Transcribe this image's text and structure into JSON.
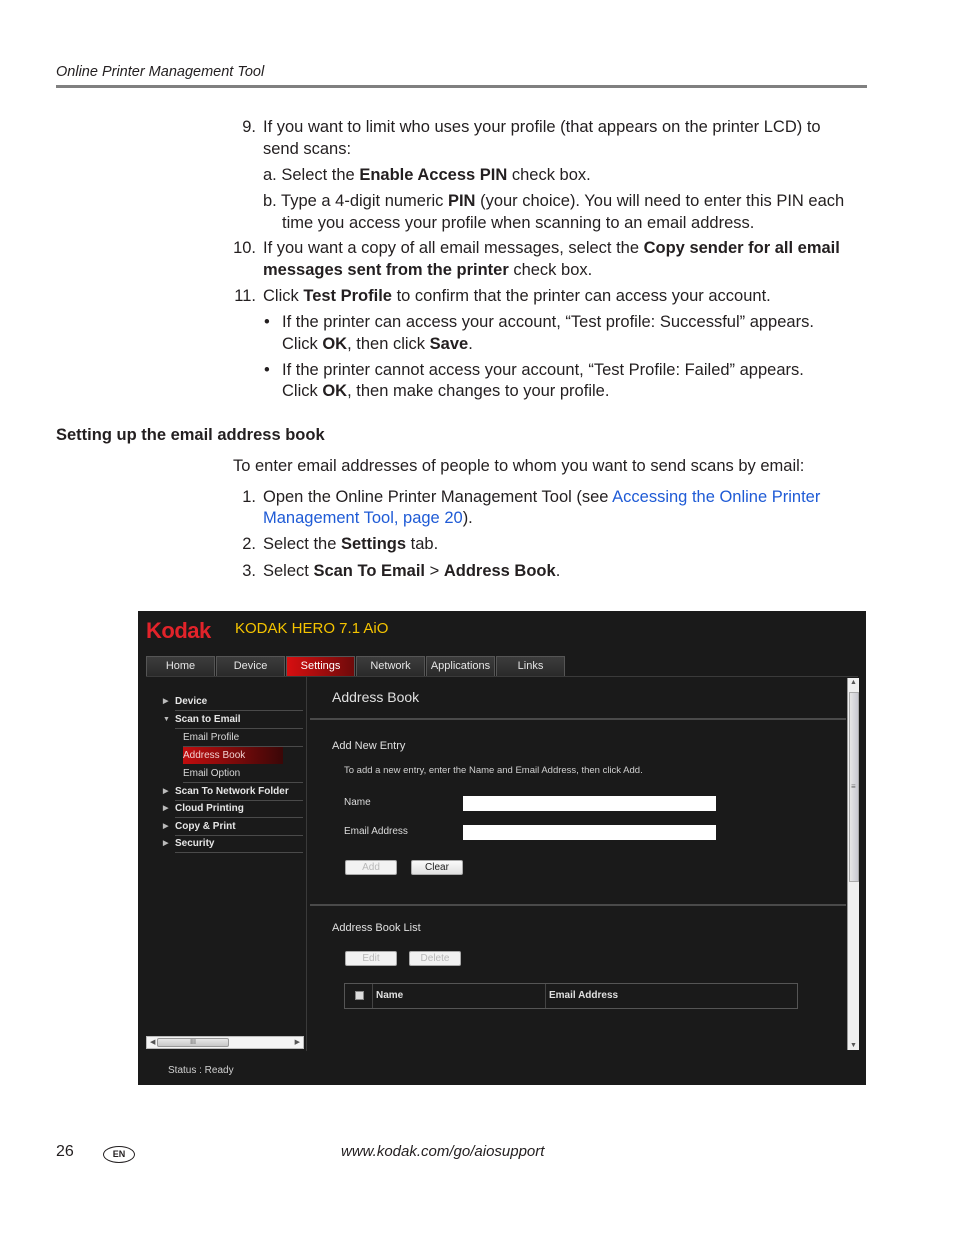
{
  "header": {
    "running_title": "Online Printer Management Tool"
  },
  "steps_top": [
    {
      "num": "9.",
      "text_html": "If you want to limit who uses your profile (that appears on the printer LCD) to"
    },
    {
      "num": "",
      "text_html": "send scans:"
    }
  ],
  "step9": {
    "num": "9.",
    "line1": "If you want to limit who uses your profile (that appears on the printer LCD) to",
    "line2": "send scans:",
    "a": {
      "pre": "a. Select the ",
      "bold": "Enable Access PIN",
      "post": " check box."
    },
    "b": {
      "pre": "b. Type a 4-digit numeric ",
      "bold": "PIN",
      "post": " (your choice). You will need to enter this PIN each",
      "line2": "time you access your profile when scanning to an email address."
    }
  },
  "step10": {
    "num": "10.",
    "pre": "If you want a copy of all email messages, select the ",
    "bold1": "Copy sender for all email",
    "bold2": "messages sent from the printer",
    "post": " check box."
  },
  "step11": {
    "num": "11.",
    "pre": "Click ",
    "bold": "Test Profile",
    "post": " to confirm that the printer can access your account.",
    "bullets": [
      {
        "line1": "If the printer can access your account, “Test profile: Successful” appears.",
        "pre": "Click ",
        "b1": "OK",
        "mid": ", then click ",
        "b2": "Save",
        "post": "."
      },
      {
        "line1": "If the printer cannot access your account, “Test Profile: Failed” appears.",
        "pre": "Click ",
        "b1": "OK",
        "mid": ", then make changes to your profile.",
        "b2": "",
        "post": ""
      }
    ]
  },
  "section": {
    "title": "Setting up the email address book",
    "intro": "To enter email addresses of people to whom you want to send scans by email:",
    "steps": [
      {
        "num": "1.",
        "pre": "Open the Online Printer Management Tool (see ",
        "link1": "Accessing the Online Printer",
        "link2": "Management Tool, page 20",
        "post": ")."
      },
      {
        "num": "2.",
        "pre": "Select the ",
        "bold": "Settings",
        "post": " tab."
      },
      {
        "num": "3.",
        "pre": "Select ",
        "bold1": "Scan To Email",
        "mid": " > ",
        "bold2": "Address Book",
        "post": "."
      }
    ]
  },
  "app": {
    "logo": "Kodak",
    "product": "KODAK HERO 7.1 AiO",
    "tabs": [
      "Home",
      "Device",
      "Settings",
      "Network",
      "Applications",
      "Links"
    ],
    "active_tab": "Settings",
    "sidebar": {
      "device": "Device",
      "scan_to_email": "Scan to Email",
      "sub": [
        "Email Profile",
        "Address Book",
        "Email Option"
      ],
      "active_sub": "Address Book",
      "rest": [
        "Scan To Network Folder",
        "Cloud Printing",
        "Copy & Print",
        "Security"
      ]
    },
    "page_heading": "Address Book",
    "add_entry": {
      "title": "Add New Entry",
      "help": "To add a new entry, enter the Name and Email Address, then click Add.",
      "name_label": "Name",
      "name_value": "",
      "email_label": "Email Address",
      "email_value": "",
      "add_button": "Add",
      "clear_button": "Clear"
    },
    "list": {
      "title": "Address Book List",
      "edit_button": "Edit",
      "delete_button": "Delete",
      "columns": [
        "Name",
        "Email Address"
      ]
    },
    "hscroll_grip": "III",
    "status": "Status : Ready"
  },
  "footer": {
    "page_number": "26",
    "lang_badge": "EN",
    "url": "www.kodak.com/go/aiosupport"
  }
}
